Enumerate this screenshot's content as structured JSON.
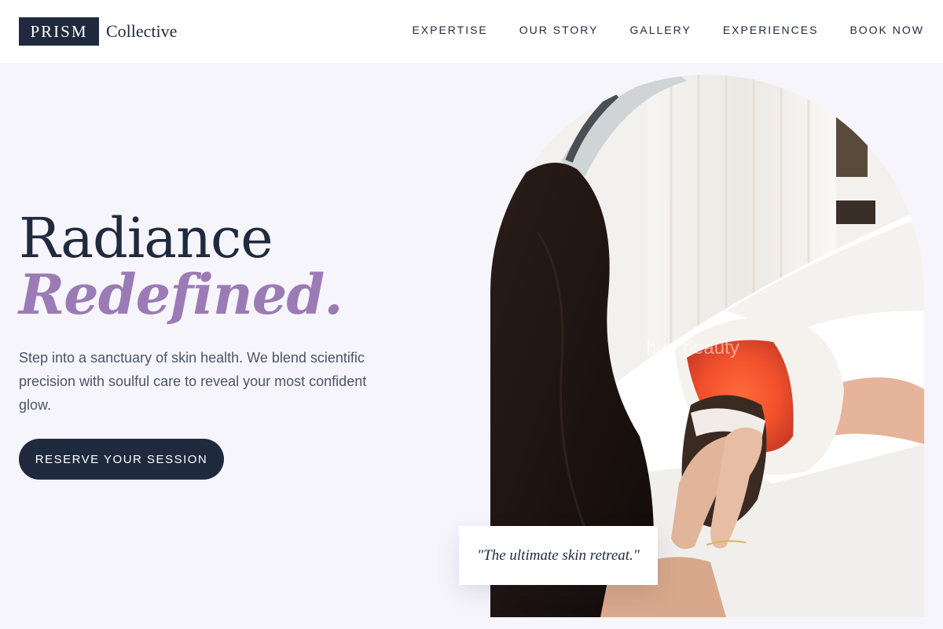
{
  "brand": {
    "box_text": "PRISM",
    "word": "Collective"
  },
  "nav": {
    "items": [
      {
        "label": "EXPERTISE"
      },
      {
        "label": "OUR STORY"
      },
      {
        "label": "GALLERY"
      },
      {
        "label": "EXPERIENCES"
      },
      {
        "label": "BOOK NOW"
      }
    ]
  },
  "hero": {
    "title_line1": "Radiance",
    "title_line2": "Redefined.",
    "description": "Step into a sanctuary of skin health. We blend scientific precision with soulful care to reveal your most confident glow.",
    "cta_label": "RESERVE YOUR SESSION"
  },
  "image": {
    "watermark": "hue.beauty"
  },
  "quote": {
    "text": "\"The ultimate skin retreat.\""
  },
  "colors": {
    "navy": "#1f2a3e",
    "lavender": "#9b7bb5",
    "background": "#f6f5fb",
    "body_text": "#4b5567"
  }
}
